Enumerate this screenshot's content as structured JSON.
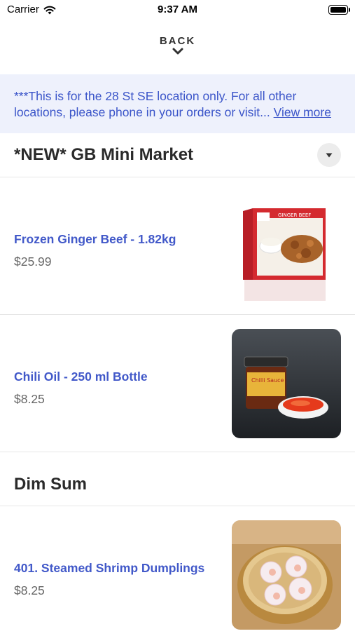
{
  "status_bar": {
    "carrier": "Carrier",
    "time": "9:37 AM"
  },
  "nav": {
    "back_label": "BACK"
  },
  "notice": {
    "text": "***This is for the 28 St SE location only. For all other locations, please phone in your orders or visit...",
    "link_label": "View more"
  },
  "sections": [
    {
      "title": "*NEW* GB Mini Market",
      "items": [
        {
          "name": "Frozen Ginger Beef - 1.82kg",
          "price": "$25.99",
          "image": "ginger-beef-box"
        },
        {
          "name": "Chili Oil - 250 ml Bottle",
          "price": "$8.25",
          "image": "chili-oil-jar"
        }
      ]
    },
    {
      "title": "Dim Sum",
      "items": [
        {
          "name": "401. Steamed Shrimp Dumplings",
          "price": "$8.25",
          "image": "shrimp-dumplings-steamer"
        }
      ]
    }
  ],
  "colors": {
    "accent": "#4259c9",
    "notice_bg": "#eef1fc"
  },
  "icons": {
    "wifi": "wifi-icon",
    "battery": "battery-icon",
    "back": "chevron-down-icon",
    "dropdown": "caret-down-icon"
  }
}
